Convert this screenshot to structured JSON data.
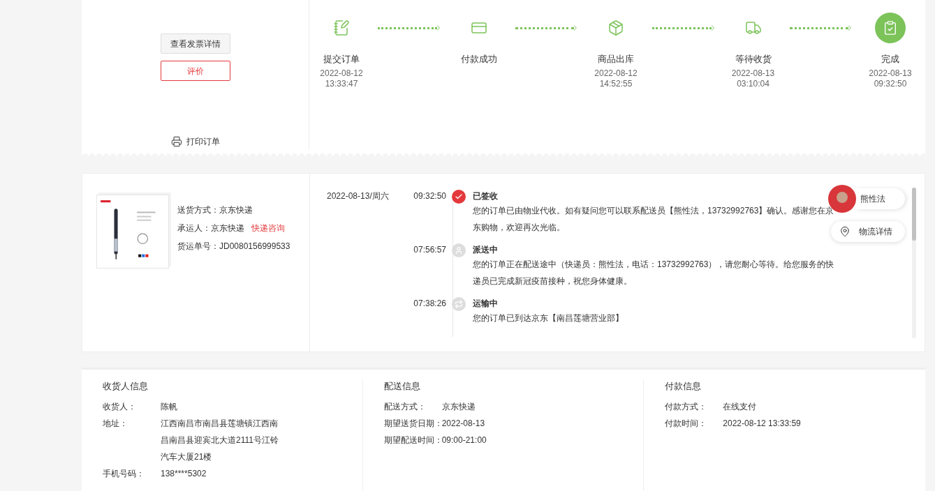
{
  "order_actions": {
    "buttons": [
      {
        "label": "查看发票详情",
        "kind": "default"
      },
      {
        "label": "评价",
        "kind": "primary"
      }
    ],
    "print": "打印订单"
  },
  "progress": {
    "steps": [
      {
        "kind": "submit",
        "label": "提交订单",
        "date": "2022-08-12",
        "time": "13:33:47",
        "current": false
      },
      {
        "kind": "pay",
        "label": "付款成功",
        "current": false
      },
      {
        "kind": "outbound",
        "label": "商品出库",
        "date": "2022-08-12",
        "time": "14:52:55",
        "current": false
      },
      {
        "kind": "shipping",
        "label": "等待收货",
        "date": "2022-08-13",
        "time": "03:10:04",
        "current": false
      },
      {
        "kind": "done",
        "label": "完成",
        "date": "2022-08-13",
        "time": "09:32:50",
        "current": true
      }
    ]
  },
  "shipment": {
    "fields": [
      {
        "label": "送货方式：",
        "value": "京东快递"
      },
      {
        "label": "承运人：",
        "value": "京东快递",
        "link": "快递咨询"
      },
      {
        "label": "货运单号：",
        "value": "JD0080156999533"
      }
    ]
  },
  "tracking": {
    "events": [
      {
        "kind": "signed",
        "active": true,
        "date": "2022-08-13/周六",
        "time": "09:32:50",
        "title": "已签收",
        "text": "您的订单已由物业代收。如有疑问您可以联系配送员【熊性法，13732992763】确认。感谢您在京东购物，欢迎再次光临。"
      },
      {
        "kind": "courier",
        "active": false,
        "time": "07:56:57",
        "title": "派送中",
        "text": "您的订单正在配送途中（快递员：熊性法，电话：13732992763），请您耐心等待。给您服务的快递员已完成新冠疫苗接种，祝您身体健康。"
      },
      {
        "kind": "transit",
        "active": false,
        "time": "07:38:26",
        "title": "运输中",
        "text": "您的订单已到达京东【南昌莲塘营业部】"
      }
    ],
    "courier_button": "熊性法",
    "details_button": "物流详情"
  },
  "info": [
    {
      "title": "收货人信息",
      "rows": [
        {
          "label": "收货人：",
          "value": "陈帆"
        },
        {
          "label": "地址：",
          "value": "江西南昌市南昌县莲塘镇江西南昌南昌县迎宾北大道2111号江铃汽车大厦21楼"
        },
        {
          "label": "手机号码：",
          "value": "138****5302"
        }
      ]
    },
    {
      "title": "配送信息",
      "rows": [
        {
          "label": "配送方式：",
          "value": "京东快递"
        },
        {
          "label": "期望送货日期：",
          "value": "2022-08-13"
        },
        {
          "label": "期望配送时间：",
          "value": "09:00-21:00"
        }
      ]
    },
    {
      "title": "付款信息",
      "rows": [
        {
          "label": "付款方式：",
          "value": "在线支付"
        },
        {
          "label": "付款时间：",
          "value": "2022-08-12 13:33:59"
        }
      ]
    }
  ]
}
